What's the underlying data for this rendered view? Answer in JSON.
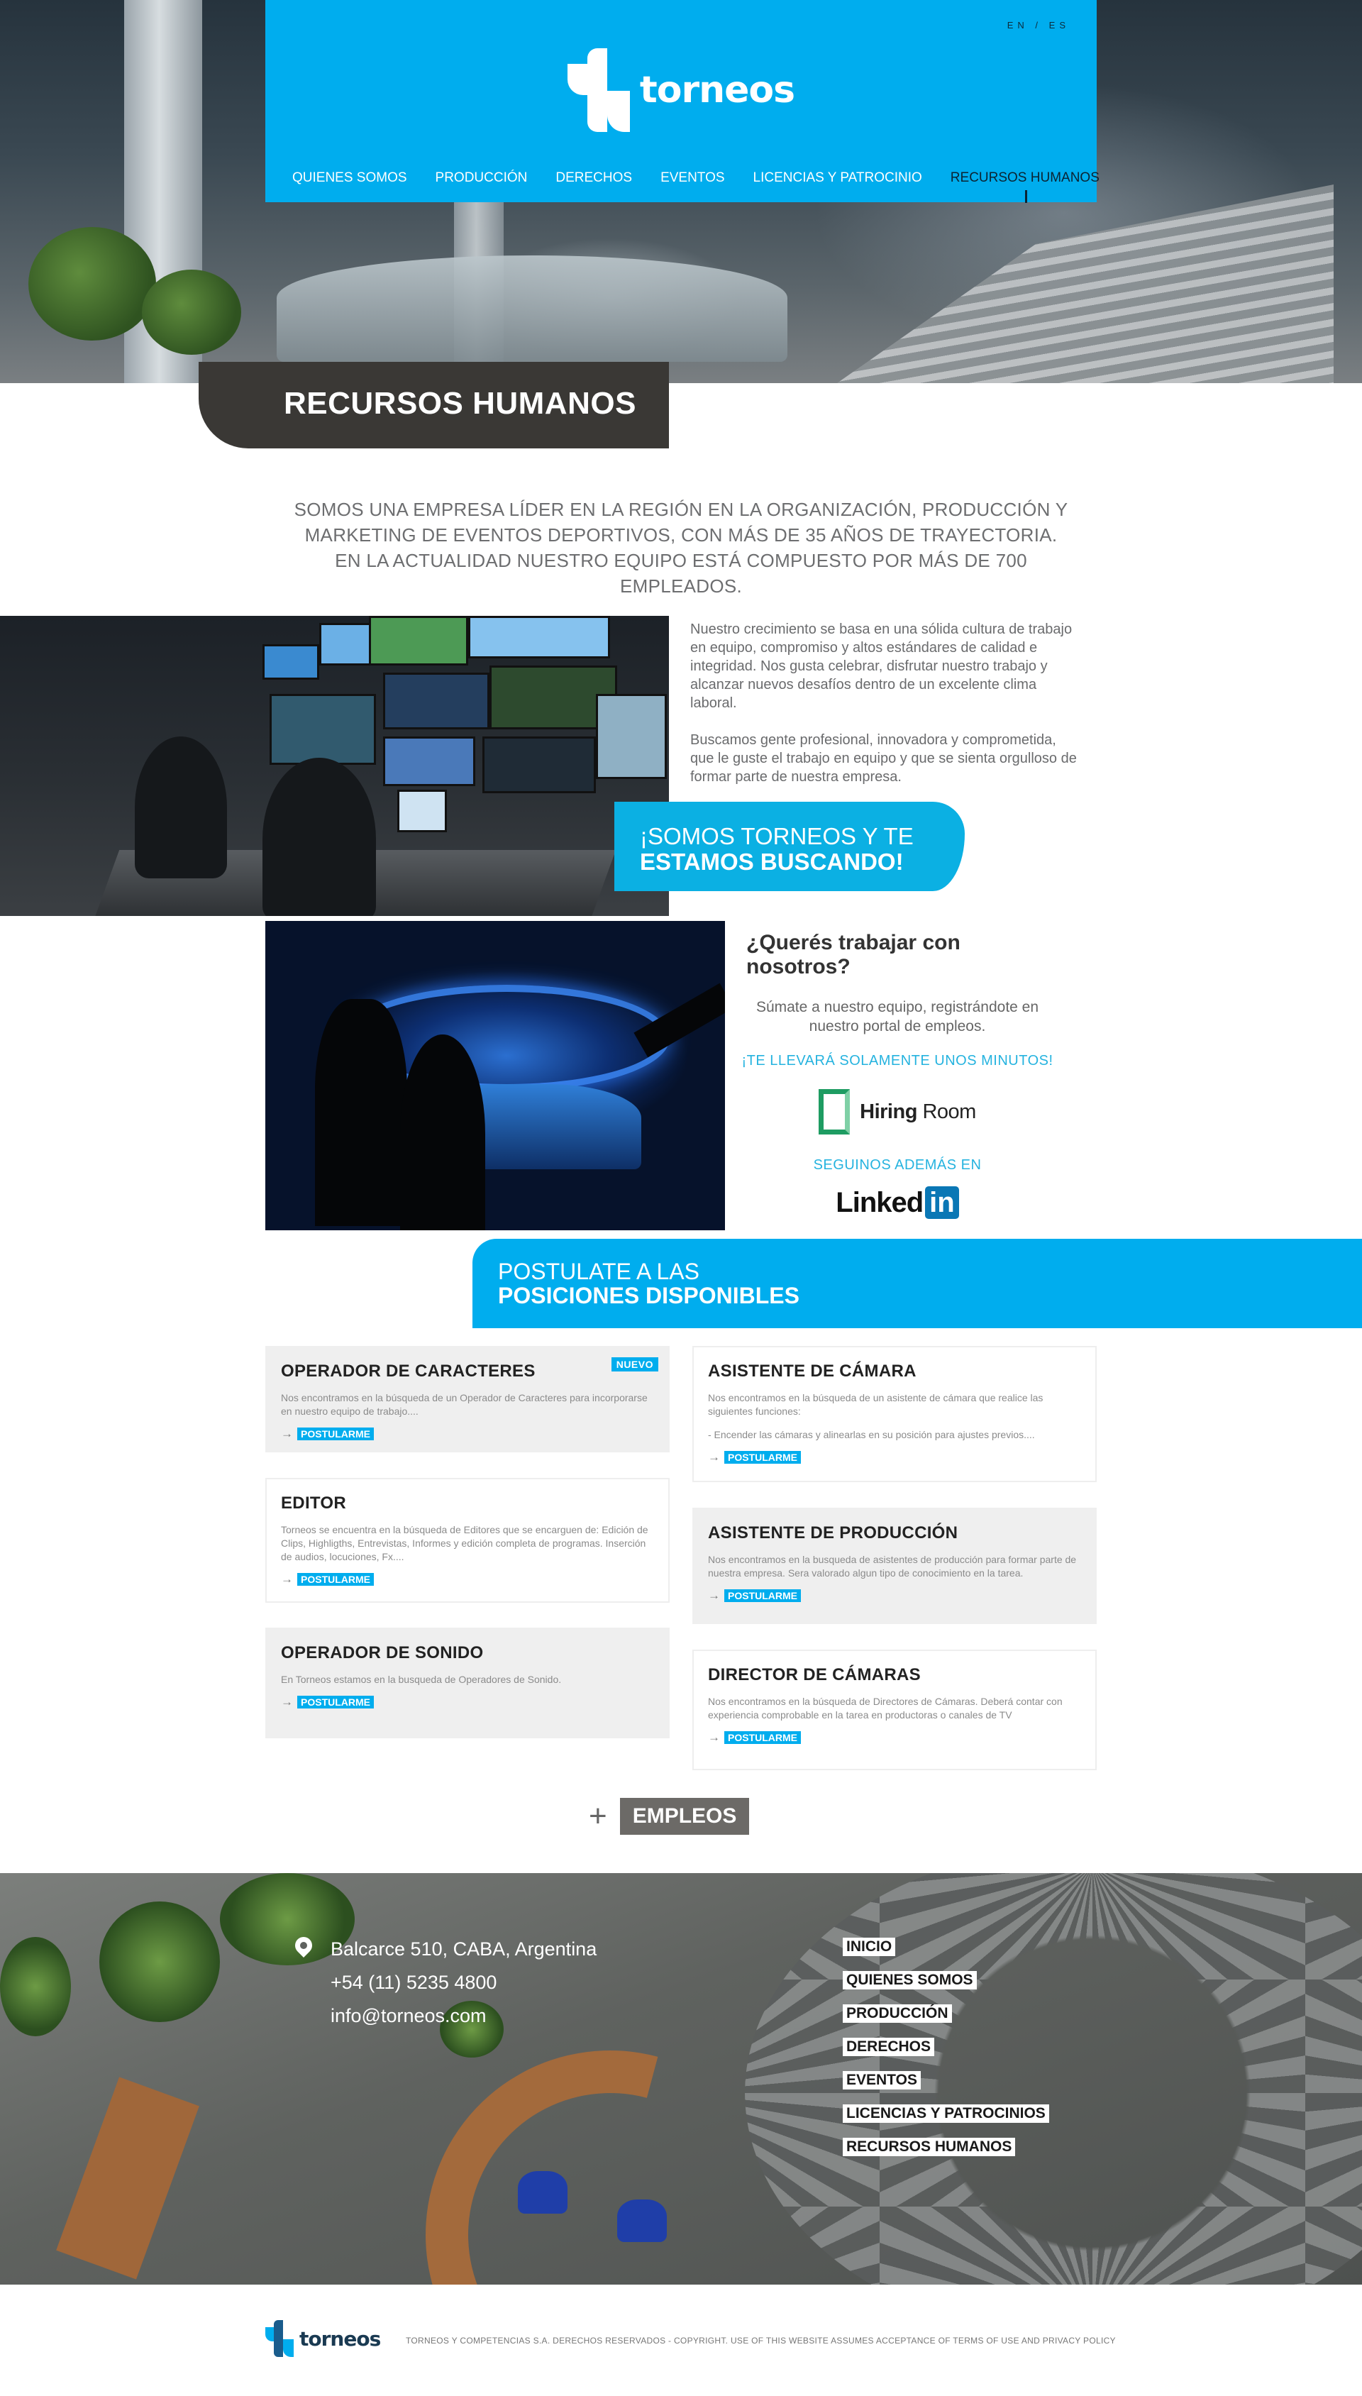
{
  "header": {
    "lang": "EN / ES",
    "brand": "torneos",
    "nav": [
      "QUIENES SOMOS",
      "PRODUCCIÓN",
      "DERECHOS",
      "EVENTOS",
      "LICENCIAS Y PATROCINIO"
    ],
    "nav_active": "RECURSOS HUMANOS",
    "accent": "#00adee"
  },
  "page": {
    "title": "RECURSOS HUMANOS",
    "intro": "SOMOS UNA EMPRESA LÍDER EN LA REGIÓN EN LA ORGANIZACIÓN, PRODUCCIÓN Y MARKETING DE EVENTOS DEPORTIVOS, CON MÁS DE 35 AÑOS DE TRAYECTORIA. EN LA ACTUALIDAD NUESTRO EQUIPO ESTÁ COMPUESTO POR MÁS DE 700 EMPLEADOS."
  },
  "culture": {
    "p1": "Nuestro crecimiento se basa en una sólida cultura de trabajo en equipo, compromiso y altos estándares de calidad e integridad. Nos gusta celebrar, disfrutar nuestro trabajo y alcanzar nuevos desafíos dentro de un excelente clima laboral.",
    "p2": "Buscamos gente profesional, innovadora y comprometida, que le guste el trabajo en equipo y que se sienta orgulloso de formar parte de nuestra empresa.",
    "banner_line1": "¡SOMOS TORNEOS Y TE",
    "banner_line2": "ESTAMOS BUSCANDO!"
  },
  "portal": {
    "heading": "¿Querés trabajar con nosotros?",
    "sub": "Súmate a nuestro equipo, registrándote en nuestro portal de empleos.",
    "minutes": "¡TE LLEVARÁ SOLAMENTE UNOS MINUTOS!",
    "hiring_bold": "Hiring",
    "hiring_light": " Room",
    "follow": "SEGUINOS ADEMÁS EN",
    "linkedin_text": "Linked",
    "linkedin_box": "in"
  },
  "positions": {
    "line1": "POSTULATE A LAS",
    "line2": "POSICIONES DISPONIBLES",
    "apply_label": "POSTULARME",
    "new_label": "NUEVO",
    "jobs": [
      {
        "title": "OPERADOR DE CARACTERES",
        "desc": "Nos encontramos en la búsqueda de un Operador de Caracteres para incorporarse en nuestro equipo de trabajo...."
      },
      {
        "title": "ASISTENTE DE CÁMARA",
        "desc": "Nos encontramos en la búsqueda de un asistente de cámara que realice las siguientes funciones:",
        "desc2": "- Encender las cámaras y alinearlas en su posición para  ajustes previos...."
      },
      {
        "title": "EDITOR",
        "desc": "Torneos se encuentra en la búsqueda de Editores que se encarguen de: Edición de Clips, Highligths, Entrevistas, Informes y edición completa de programas. Inserción de audios, locuciones, Fx...."
      },
      {
        "title": "ASISTENTE DE PRODUCCIÓN",
        "desc": "Nos encontramos en la busqueda de asistentes de producción para formar parte de nuestra empresa. Sera valorado algun tipo de conocimiento en la tarea."
      },
      {
        "title": "OPERADOR DE SONIDO",
        "desc": "En Torneos estamos en la busqueda de Operadores de Sonido."
      },
      {
        "title": "DIRECTOR DE CÁMARAS",
        "desc": "Nos encontramos en la búsqueda de Directores de Cámaras. Deberá contar con experiencia comprobable en la tarea en productoras o canales de TV"
      }
    ],
    "more_plus": "+",
    "more_label": "EMPLEOS"
  },
  "footer": {
    "address": "Balcarce 510, CABA, Argentina",
    "phone": "+54 (11) 5235 4800",
    "email": "info@torneos.com",
    "nav": [
      "INICIO",
      "QUIENES SOMOS",
      "PRODUCCIÓN",
      "DERECHOS",
      "EVENTOS",
      "LICENCIAS Y PATROCINIOS",
      "RECURSOS HUMANOS"
    ],
    "brand": "torneos",
    "copyright": "TORNEOS Y COMPETENCIAS S.A. DERECHOS RESERVADOS - COPYRIGHT. USE OF THIS WEBSITE ASSUMES ACCEPTANCE OF TERMS OF USE AND PRIVACY POLICY"
  }
}
